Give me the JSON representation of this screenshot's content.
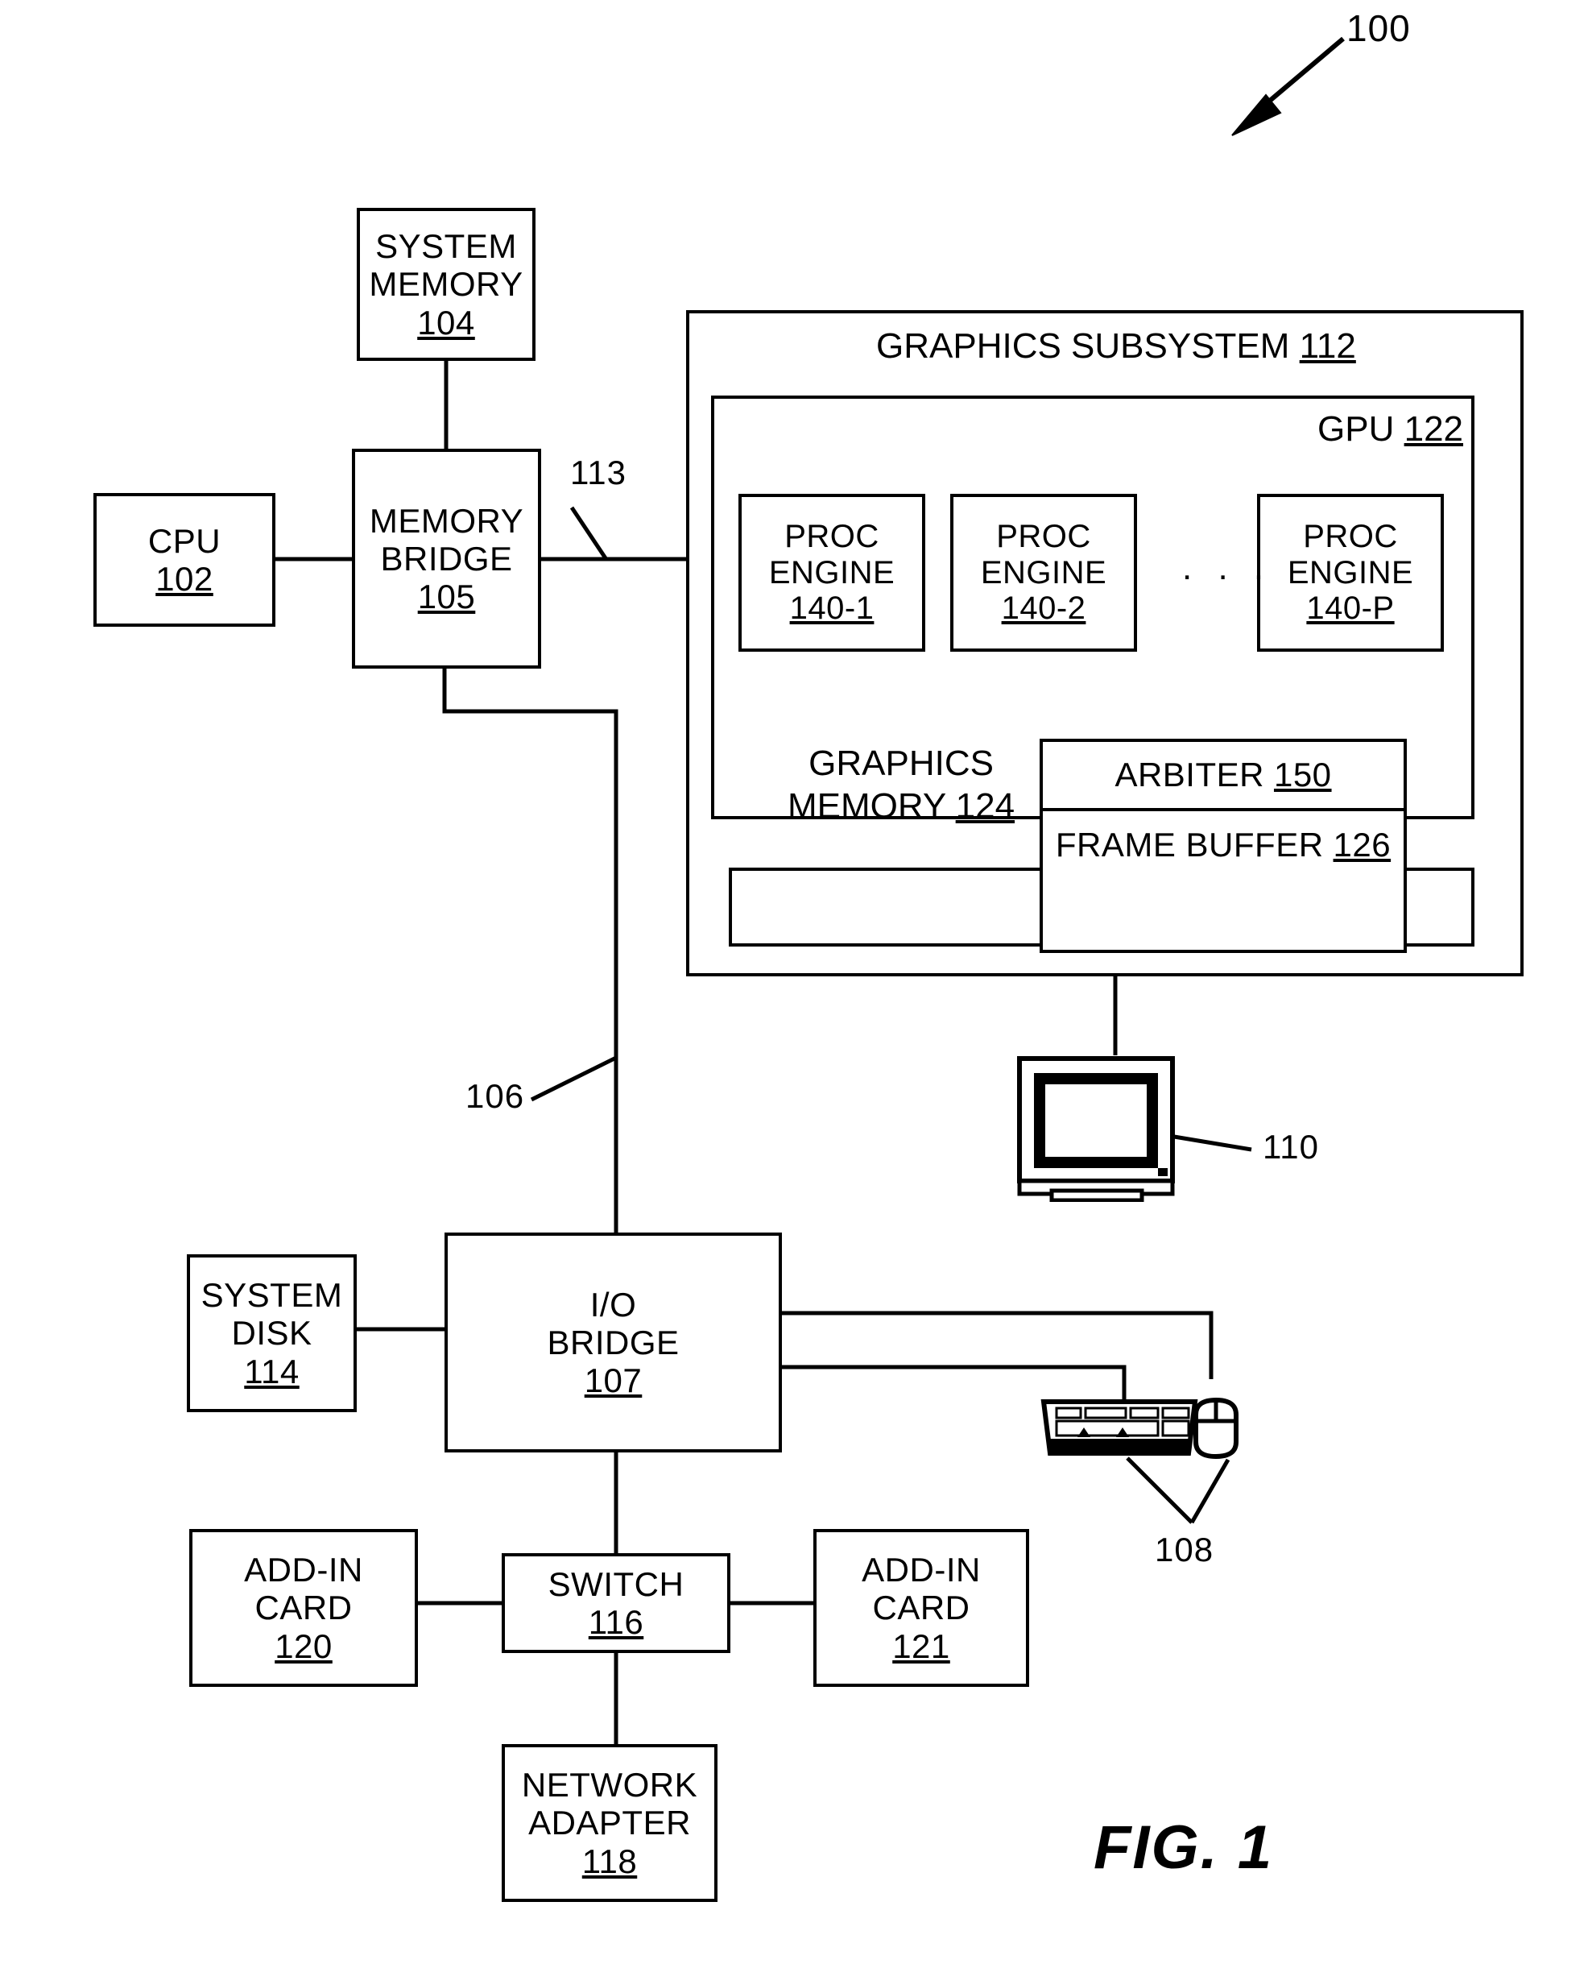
{
  "figure": {
    "label": "FIG. 1",
    "system_ref": "100"
  },
  "blocks": {
    "system_memory": {
      "line1": "SYSTEM",
      "line2": "MEMORY",
      "ref": "104"
    },
    "cpu": {
      "line1": "CPU",
      "ref": "102"
    },
    "memory_bridge": {
      "line1": "MEMORY",
      "line2": "BRIDGE",
      "ref": "105"
    },
    "system_disk": {
      "line1": "SYSTEM",
      "line2": "DISK",
      "ref": "114"
    },
    "io_bridge": {
      "line1": "I/O",
      "line2": "BRIDGE",
      "ref": "107"
    },
    "add_in_card_120": {
      "line1": "ADD-IN",
      "line2": "CARD",
      "ref": "120"
    },
    "switch": {
      "line1": "SWITCH",
      "ref": "116"
    },
    "add_in_card_121": {
      "line1": "ADD-IN",
      "line2": "CARD",
      "ref": "121"
    },
    "network_adapter": {
      "line1": "NETWORK",
      "line2": "ADAPTER",
      "ref": "118"
    },
    "proc_engine_1": {
      "line1": "PROC",
      "line2": "ENGINE",
      "ref": "140-1"
    },
    "proc_engine_2": {
      "line1": "PROC",
      "line2": "ENGINE",
      "ref": "140-2"
    },
    "proc_engine_p": {
      "line1": "PROC",
      "line2": "ENGINE",
      "ref": "140-P"
    },
    "arbiter": {
      "text": "ARBITER",
      "ref": "150"
    },
    "frame_buffer": {
      "text": "FRAME BUFFER",
      "ref": "126"
    }
  },
  "groups": {
    "graphics_subsystem": {
      "text": "GRAPHICS SUBSYSTEM",
      "ref": "112"
    },
    "gpu": {
      "text": "GPU",
      "ref": "122"
    },
    "graphics_memory": {
      "line1": "GRAPHICS",
      "line2": "MEMORY",
      "ref": "124"
    }
  },
  "bus_labels": {
    "path_113": "113",
    "path_106": "106"
  },
  "peripherals": {
    "display": {
      "ref": "110",
      "icon": "crt-monitor-icon"
    },
    "input_devices": {
      "ref": "108",
      "keyboard_icon": "keyboard-icon",
      "mouse_icon": "mouse-icon"
    }
  },
  "misc": {
    "ellipsis": ". . ."
  },
  "colors": {
    "ink": "#000000",
    "paper": "#ffffff"
  }
}
